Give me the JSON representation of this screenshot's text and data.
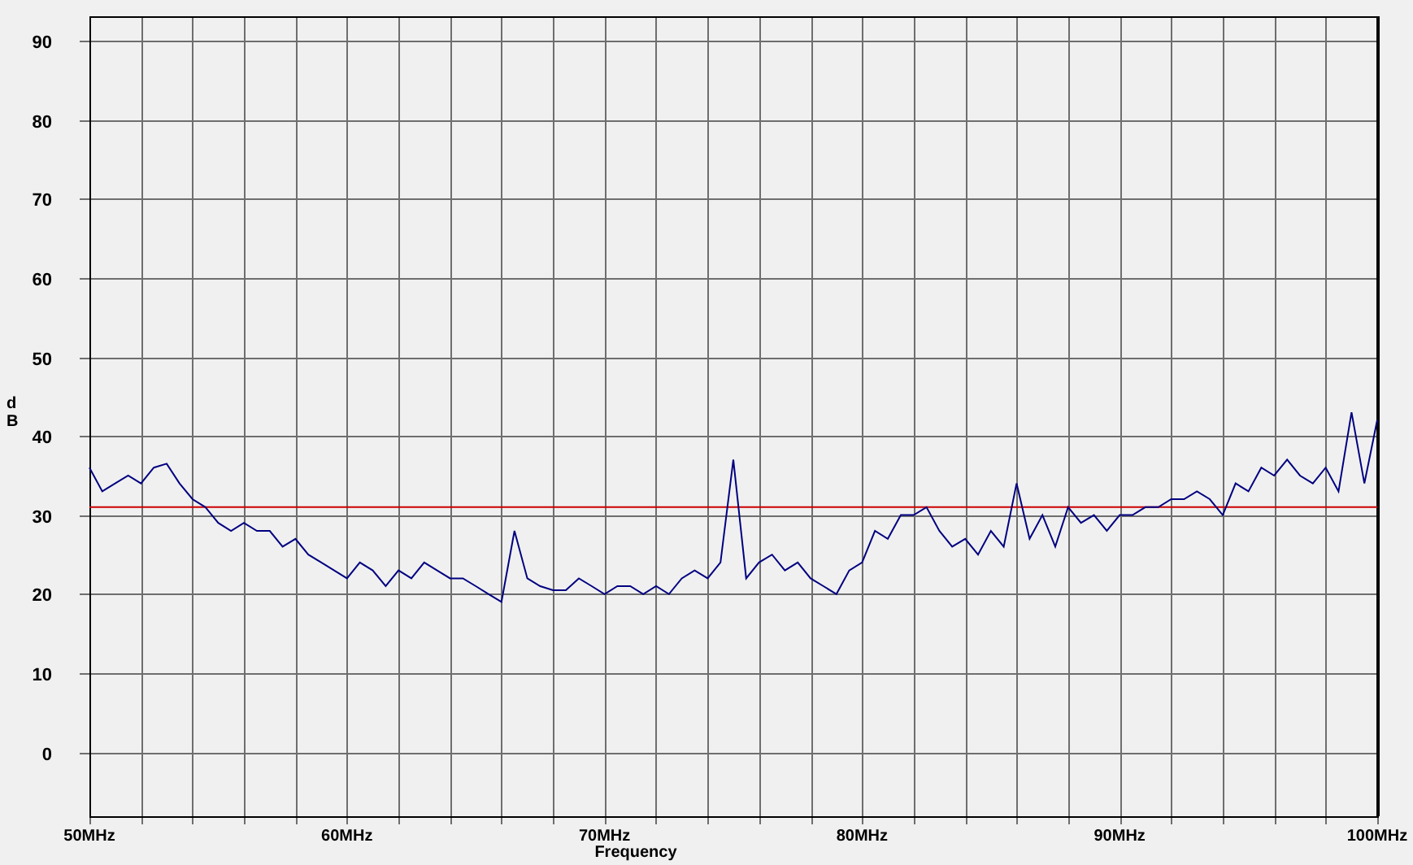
{
  "chart_data": {
    "type": "line",
    "xlabel": "Frequency",
    "ylabel": "dB",
    "xlim": [
      50,
      100
    ],
    "ylim": [
      -8.1,
      93.1
    ],
    "xticks": [
      {
        "value": 50,
        "label": "50MHz"
      },
      {
        "value": 60,
        "label": "60MHz"
      },
      {
        "value": 70,
        "label": "70MHz"
      },
      {
        "value": 80,
        "label": "80MHz"
      },
      {
        "value": 90,
        "label": "90MHz"
      },
      {
        "value": 100,
        "label": "100MHz"
      }
    ],
    "yticks": [
      0,
      10,
      20,
      30,
      40,
      50,
      60,
      70,
      80,
      90
    ],
    "x": [
      50,
      50.5,
      51,
      51.5,
      52,
      52.5,
      53,
      53.5,
      54,
      54.5,
      55,
      55.5,
      56,
      56.5,
      57,
      57.5,
      58,
      58.5,
      59,
      59.5,
      60,
      60.5,
      61,
      61.5,
      62,
      62.5,
      63,
      63.5,
      64,
      64.5,
      65,
      65.5,
      66,
      66.5,
      67,
      67.5,
      68,
      68.5,
      69,
      69.5,
      70,
      70.5,
      71,
      71.5,
      72,
      72.5,
      73,
      73.5,
      74,
      74.5,
      75,
      75.5,
      76,
      76.5,
      77,
      77.5,
      78,
      78.5,
      79,
      79.5,
      80,
      80.5,
      81,
      81.5,
      82,
      82.5,
      83,
      83.5,
      84,
      84.5,
      85,
      85.5,
      86,
      86.5,
      87,
      87.5,
      88,
      88.5,
      89,
      89.5,
      90,
      90.5,
      91,
      91.5,
      92,
      92.5,
      93,
      93.5,
      94,
      94.5,
      95,
      95.5,
      96,
      96.5,
      97,
      97.5,
      98,
      98.5,
      99,
      99.5,
      100
    ],
    "series": [
      {
        "color": "#000080",
        "values": [
          36,
          33,
          34,
          35,
          34,
          36,
          36.5,
          34,
          32,
          31,
          29,
          28,
          29,
          28,
          28,
          26,
          27,
          25,
          24,
          23,
          22,
          24,
          23,
          21,
          23,
          22,
          24,
          23,
          22,
          22,
          21,
          20,
          19,
          28,
          22,
          21,
          20.5,
          20.5,
          22,
          21,
          20,
          21,
          21,
          20,
          21,
          20,
          22,
          23,
          22,
          24,
          37,
          22,
          24,
          25,
          23,
          24,
          22,
          21,
          20,
          23,
          24,
          28,
          27,
          30,
          30,
          31,
          28,
          26,
          27,
          25,
          28,
          26,
          34,
          27,
          30,
          26,
          31,
          29,
          30,
          28,
          30,
          30,
          31,
          31,
          32,
          32,
          33,
          32,
          30,
          34,
          33,
          36,
          35,
          37,
          35,
          34,
          36,
          33,
          43,
          34,
          42
        ]
      },
      {
        "color": "#cc0000",
        "values": [
          31,
          31,
          31,
          31,
          31,
          31,
          31,
          31,
          31,
          31,
          31,
          31,
          31,
          31,
          31,
          31,
          31,
          31,
          31,
          31,
          31,
          31,
          31,
          31,
          31,
          31,
          31,
          31,
          31,
          31,
          31,
          31,
          31,
          31,
          31,
          31,
          31,
          31,
          31,
          31,
          31,
          31,
          31,
          31,
          31,
          31,
          31,
          31,
          31,
          31,
          31,
          31,
          31,
          31,
          31,
          31,
          31,
          31,
          31,
          31,
          31,
          31,
          31,
          31,
          31,
          31,
          31,
          31,
          31,
          31,
          31,
          31,
          31,
          31,
          31,
          31,
          31,
          31,
          31,
          31,
          31,
          31,
          31,
          31,
          31,
          31,
          31,
          31,
          31,
          31,
          31,
          31,
          31,
          31,
          31,
          31,
          31,
          31,
          31,
          31,
          31
        ]
      }
    ],
    "grid": true
  }
}
